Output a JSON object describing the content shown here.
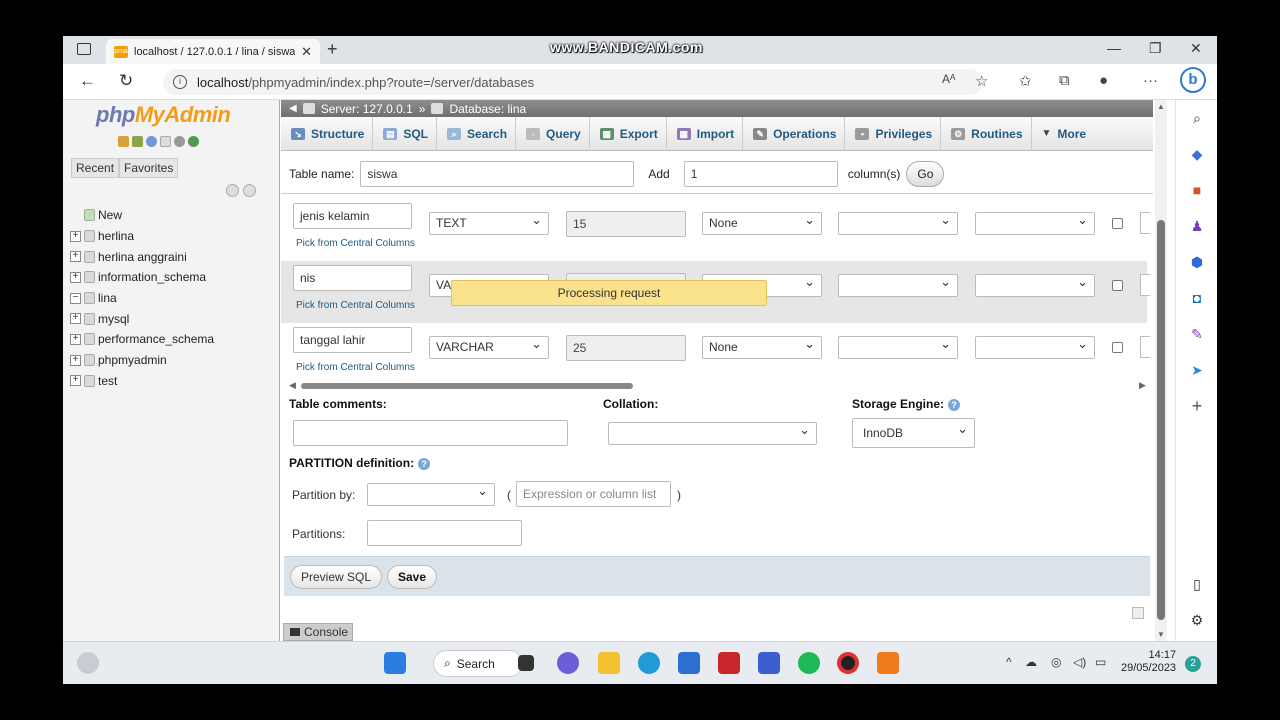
{
  "browser": {
    "tab_title": "localhost / 127.0.0.1 / lina / siswa",
    "tab_close": "✕",
    "new_tab": "+",
    "watermark": "www.BANDICAM.com",
    "url_host": "localhost",
    "url_path": "/phpmyadmin/index.php?route=/server/databases",
    "read_aloud": "Aᴬ",
    "more": "···"
  },
  "pma": {
    "logo_php": "php",
    "logo_myadmin": "MyAdmin",
    "left_tabs": [
      "Recent",
      "Favorites"
    ],
    "tree": [
      {
        "label": "New",
        "exp": ""
      },
      {
        "label": "herlina",
        "exp": "+"
      },
      {
        "label": "herlina anggraini",
        "exp": "+"
      },
      {
        "label": "information_schema",
        "exp": "+"
      },
      {
        "label": "lina",
        "exp": "−"
      },
      {
        "label": "mysql",
        "exp": "+"
      },
      {
        "label": "performance_schema",
        "exp": "+"
      },
      {
        "label": "phpmyadmin",
        "exp": "+"
      },
      {
        "label": "test",
        "exp": "+"
      }
    ],
    "breadcrumb": {
      "server": "Server: 127.0.0.1",
      "sep": "»",
      "database": "Database: lina"
    },
    "menu": [
      "Structure",
      "SQL",
      "Search",
      "Query",
      "Export",
      "Import",
      "Operations",
      "Privileges",
      "Routines",
      "More"
    ],
    "table_name_label": "Table name:",
    "table_name_value": "siswa",
    "add_label": "Add",
    "add_value": "1",
    "columns_label": "column(s)",
    "go_label": "Go",
    "pick_label": "Pick from Central Columns",
    "rows": [
      {
        "name": "jenis kelamin",
        "type": "TEXT",
        "length": "15",
        "default": "None"
      },
      {
        "name": "nis",
        "type": "VA",
        "length": "",
        "default": ""
      },
      {
        "name": "tanggal lahir",
        "type": "VARCHAR",
        "length": "25",
        "default": "None"
      }
    ],
    "processing": "Processing request",
    "table_comments_label": "Table comments:",
    "collation_label": "Collation:",
    "storage_engine_label": "Storage Engine:",
    "storage_engine_value": "InnoDB",
    "partition_label": "PARTITION definition:",
    "partition_by_label": "Partition by:",
    "expression_placeholder": "Expression or column list",
    "paren_open": "(",
    "paren_close": ")",
    "partitions_label": "Partitions:",
    "preview_sql": "Preview SQL",
    "save": "Save",
    "console": "Console"
  },
  "taskbar": {
    "search": "Search",
    "time": "14:17",
    "date": "29/05/2023",
    "notifications": "2"
  },
  "colors": {
    "link": "#235a81",
    "toast": "#fbe28c",
    "logo_php": "#6c78af",
    "logo_myadmin": "#f29d1a"
  }
}
